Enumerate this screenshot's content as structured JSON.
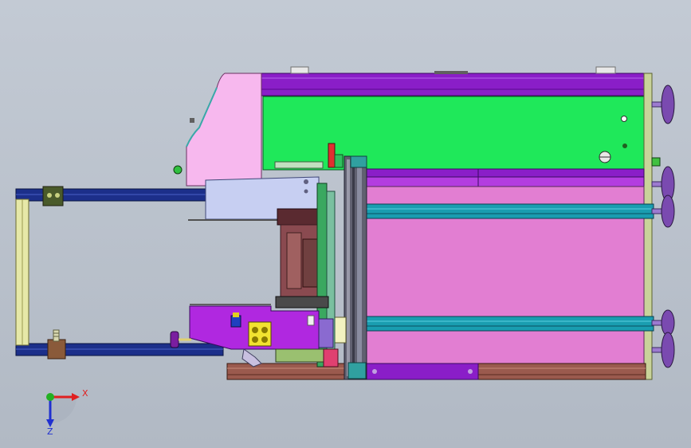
{
  "viewport": {
    "background_top": "#c3cad4",
    "background_bottom": "#b1b9c4"
  },
  "triad": {
    "x_label": "X",
    "z_label": "Z",
    "x_color": "#e02020",
    "y_color": "#22b022",
    "z_color": "#2030d0"
  },
  "colors": {
    "purple": "#8a1ec8",
    "green": "#1fe85a",
    "pink": "#e27ed2",
    "light_pink": "#f7b8ee",
    "teal": "#1a9db0",
    "navy": "#1c2f8a",
    "brown_frame": "#9a5a4e",
    "olive": "#c9d39a",
    "lavender": "#9c7ad0",
    "yellow": "#f2e230",
    "light_blue": "#c7cff2"
  }
}
